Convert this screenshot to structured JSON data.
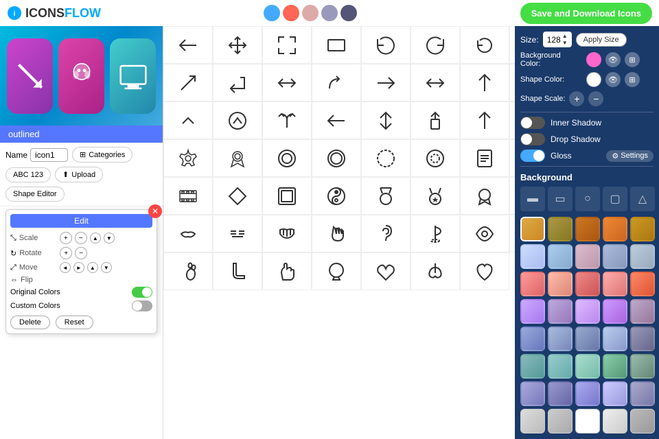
{
  "header": {
    "logo_text_icons": "ICONS",
    "logo_text_flow": "FLOW",
    "save_btn_label": "Save and Download Icons"
  },
  "toolbar": {
    "style_label": "outlined",
    "name_label": "Name",
    "name_value": "icon1",
    "categories_btn": "Categories",
    "abc_btn": "ABC 123",
    "upload_btn": "Upload",
    "shape_editor_btn": "Shape Editor"
  },
  "edit_menu": {
    "title": "Edit",
    "scale_label": "Scale",
    "rotate_label": "Rotate",
    "move_label": "Move",
    "flip_label": "Flip",
    "original_colors_label": "Original Colors",
    "custom_colors_label": "Custom Colors",
    "delete_btn": "Delete",
    "reset_btn": "Reset"
  },
  "right_panel": {
    "size_label": "Size:",
    "size_value": "128",
    "apply_size_label": "Apply Size",
    "bg_color_label": "Background Color:",
    "shape_color_label": "Shape Color:",
    "shape_scale_label": "Shape Scale:",
    "inner_shadow_label": "Inner Shadow",
    "drop_shadow_label": "Drop Shadow",
    "gloss_label": "Gloss",
    "settings_btn": "Settings",
    "background_label": "Background"
  },
  "swatches": {
    "header_colors": [
      "#44aaff",
      "#ff6655",
      "#ddaaaa",
      "#9999bb",
      "#555577"
    ],
    "bg_colors": [
      "#ddaa44",
      "#aa9944",
      "#cc7722",
      "#ee8833",
      "#cc9922",
      "#ccddff",
      "#aaccee",
      "#ddbbcc",
      "#aabbdd",
      "#bbccdd",
      "#ff9999",
      "#ffbbaa",
      "#ee8888",
      "#ffaaaa",
      "#ff8866",
      "#ccaaff",
      "#bbaadd",
      "#ddbbff",
      "#cc99ff",
      "#bbaacc",
      "#99aadd",
      "#aabbdd",
      "#99aacc",
      "#bbccee",
      "#9999bb",
      "#88bbbb",
      "#99cccc",
      "#aaddcc",
      "#88ccaa",
      "#99bbaa",
      "#aaaadd",
      "#9999cc",
      "#aaaaee",
      "#ccccff",
      "#aaaacc",
      "#dddddd",
      "#cccccc",
      "#ffffff",
      "#eeeeee",
      "#bbbbbb"
    ]
  }
}
